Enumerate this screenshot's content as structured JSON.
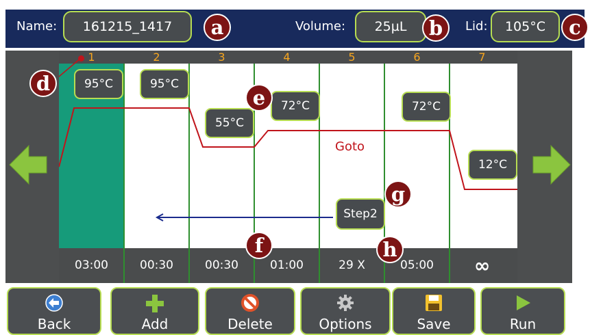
{
  "header": {
    "name_label": "Name:",
    "name_value": "161215_1417",
    "volume_label": "Volume:",
    "volume_value": "25µL",
    "lid_label": "Lid:",
    "lid_value": "105°C"
  },
  "markers": [
    "a",
    "b",
    "c",
    "d",
    "e",
    "f",
    "g",
    "h"
  ],
  "steps": [
    {
      "number": "1",
      "temp": "95°C",
      "time": "03:00"
    },
    {
      "number": "2",
      "temp": "95°C",
      "time": "00:30"
    },
    {
      "number": "3",
      "temp": "55°C",
      "time": "00:30"
    },
    {
      "number": "4",
      "temp": "72°C",
      "time": "01:00"
    },
    {
      "number": "5",
      "temp": "",
      "time": "29 X"
    },
    {
      "number": "6",
      "temp": "72°C",
      "time": "05:00"
    },
    {
      "number": "7",
      "temp": "12°C",
      "time": "∞"
    }
  ],
  "goto": {
    "label": "Goto",
    "target": "Step2"
  },
  "buttons": [
    {
      "label": "Back",
      "icon": "back-arrow-icon"
    },
    {
      "label": "Add",
      "icon": "plus-icon"
    },
    {
      "label": "Delete",
      "icon": "no-entry-icon"
    },
    {
      "label": "Options",
      "icon": "gear-icon"
    },
    {
      "label": "Save",
      "icon": "floppy-disk-icon"
    },
    {
      "label": "Run",
      "icon": "play-icon"
    }
  ],
  "colors": {
    "accent": "#b7dd52",
    "header": "#182a5c",
    "marker": "#7c1414",
    "profile_line": "#c0141b",
    "active_step": "#169b7a"
  }
}
